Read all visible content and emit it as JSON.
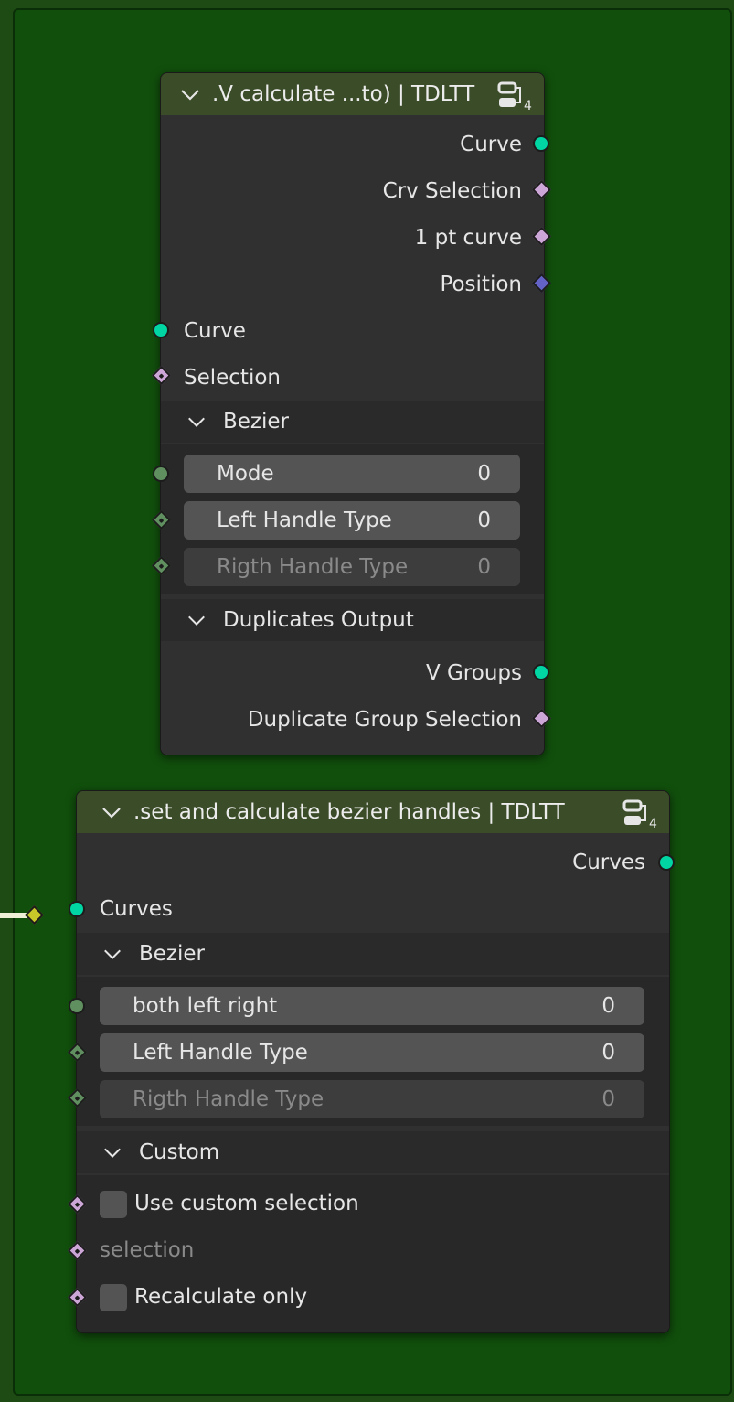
{
  "node1": {
    "title": ".V calculate ...to) | TDLTT",
    "icon_badge": "4",
    "outputs": [
      "Curve",
      "Crv Selection",
      "1 pt curve",
      "Position"
    ],
    "inputs": [
      "Curve",
      "Selection"
    ],
    "panel_bezier": {
      "label": "Bezier",
      "fields": [
        {
          "label": "Mode",
          "value": "0"
        },
        {
          "label": "Left Handle Type",
          "value": "0"
        },
        {
          "label": "Rigth Handle Type",
          "value": "0"
        }
      ]
    },
    "panel_duplicates": {
      "label": "Duplicates Output",
      "outputs": [
        "V Groups",
        "Duplicate Group Selection"
      ]
    }
  },
  "node2": {
    "title": ".set and calculate bezier handles | TDLTT",
    "icon_badge": "4",
    "outputs": [
      "Curves"
    ],
    "inputs": [
      "Curves"
    ],
    "panel_bezier": {
      "label": "Bezier",
      "fields": [
        {
          "label": "both left right",
          "value": "0"
        },
        {
          "label": "Left Handle Type",
          "value": "0"
        },
        {
          "label": "Rigth Handle Type",
          "value": "0"
        }
      ]
    },
    "panel_custom": {
      "label": "Custom",
      "use_custom_selection": "Use custom selection",
      "selection": "selection",
      "recalculate_only": "Recalculate only"
    }
  },
  "colors": {
    "frame": "#114f0c",
    "node_bg": "#303030",
    "header": "#3b4c28",
    "geometry_socket": "#00d6a3",
    "boolean_socket": "#cca6d6",
    "vector_socket": "#6363c7",
    "integer_socket": "#608f60"
  },
  "icons": {
    "collapse": "chevron-down-icon",
    "node_group": "node-group-icon"
  }
}
